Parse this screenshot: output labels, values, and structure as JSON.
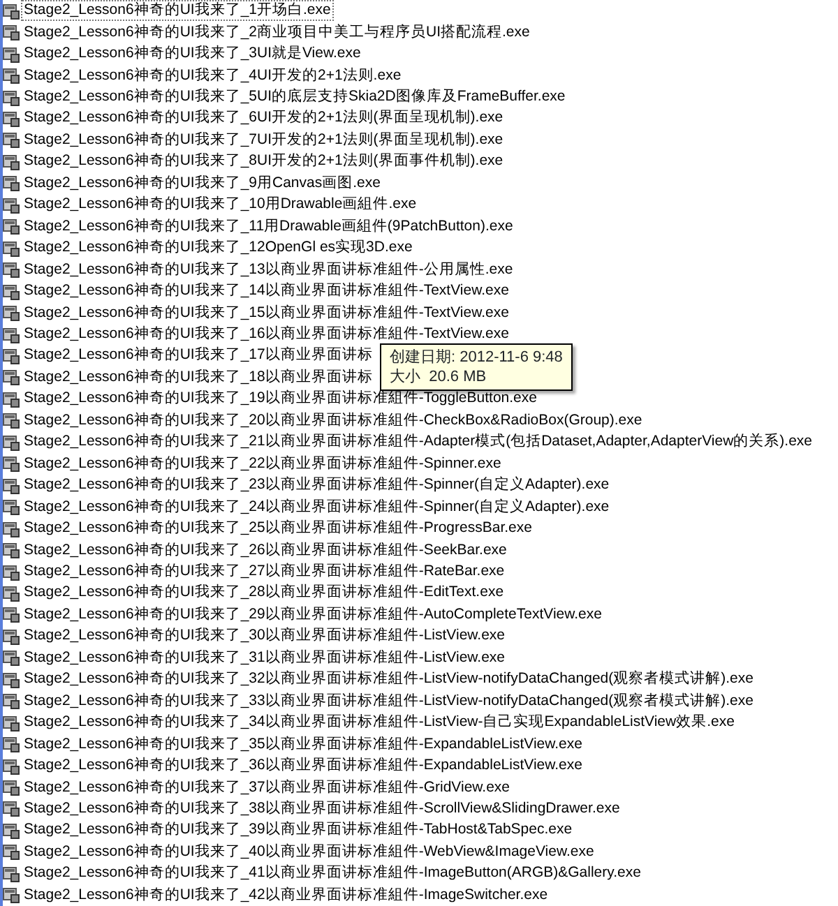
{
  "files": [
    {
      "name": "Stage2_Lesson6神奇的UI我来了_1开场白.exe",
      "focused": true
    },
    {
      "name": "Stage2_Lesson6神奇的UI我来了_2商业项目中美工与程序员UI搭配流程.exe",
      "focused": false
    },
    {
      "name": "Stage2_Lesson6神奇的UI我来了_3UI就是View.exe",
      "focused": false
    },
    {
      "name": "Stage2_Lesson6神奇的UI我来了_4UI开发的2+1法则.exe",
      "focused": false
    },
    {
      "name": "Stage2_Lesson6神奇的UI我来了_5UI的底层支持Skia2D图像库及FrameBuffer.exe",
      "focused": false
    },
    {
      "name": "Stage2_Lesson6神奇的UI我来了_6UI开发的2+1法则(界面呈现机制).exe",
      "focused": false
    },
    {
      "name": "Stage2_Lesson6神奇的UI我来了_7UI开发的2+1法则(界面呈现机制).exe",
      "focused": false
    },
    {
      "name": "Stage2_Lesson6神奇的UI我来了_8UI开发的2+1法则(界面事件机制).exe",
      "focused": false
    },
    {
      "name": "Stage2_Lesson6神奇的UI我来了_9用Canvas画图.exe",
      "focused": false
    },
    {
      "name": "Stage2_Lesson6神奇的UI我来了_10用Drawable画組件.exe",
      "focused": false
    },
    {
      "name": "Stage2_Lesson6神奇的UI我来了_11用Drawable画組件(9PatchButton).exe",
      "focused": false
    },
    {
      "name": "Stage2_Lesson6神奇的UI我来了_12OpenGl es实现3D.exe",
      "focused": false
    },
    {
      "name": "Stage2_Lesson6神奇的UI我来了_13以商业界面讲标准組件-公用属性.exe",
      "focused": false
    },
    {
      "name": "Stage2_Lesson6神奇的UI我来了_14以商业界面讲标准組件-TextView.exe",
      "focused": false
    },
    {
      "name": "Stage2_Lesson6神奇的UI我来了_15以商业界面讲标准組件-TextView.exe",
      "focused": false
    },
    {
      "name": "Stage2_Lesson6神奇的UI我来了_16以商业界面讲标准組件-TextView.exe",
      "focused": false
    },
    {
      "name": "Stage2_Lesson6神奇的UI我来了_17以商业界面讲标",
      "focused": false
    },
    {
      "name": "Stage2_Lesson6神奇的UI我来了_18以商业界面讲标",
      "focused": false
    },
    {
      "name": "Stage2_Lesson6神奇的UI我来了_19以商业界面讲标准組件-ToggleButton.exe",
      "focused": false
    },
    {
      "name": "Stage2_Lesson6神奇的UI我来了_20以商业界面讲标准組件-CheckBox&RadioBox(Group).exe",
      "focused": false
    },
    {
      "name": "Stage2_Lesson6神奇的UI我来了_21以商业界面讲标准組件-Adapter模式(包括Dataset,Adapter,AdapterView的关系).exe",
      "focused": false
    },
    {
      "name": "Stage2_Lesson6神奇的UI我来了_22以商业界面讲标准組件-Spinner.exe",
      "focused": false
    },
    {
      "name": "Stage2_Lesson6神奇的UI我来了_23以商业界面讲标准組件-Spinner(自定义Adapter).exe",
      "focused": false
    },
    {
      "name": "Stage2_Lesson6神奇的UI我来了_24以商业界面讲标准組件-Spinner(自定义Adapter).exe",
      "focused": false
    },
    {
      "name": "Stage2_Lesson6神奇的UI我来了_25以商业界面讲标准組件-ProgressBar.exe",
      "focused": false
    },
    {
      "name": "Stage2_Lesson6神奇的UI我来了_26以商业界面讲标准組件-SeekBar.exe",
      "focused": false
    },
    {
      "name": "Stage2_Lesson6神奇的UI我来了_27以商业界面讲标准組件-RateBar.exe",
      "focused": false
    },
    {
      "name": "Stage2_Lesson6神奇的UI我来了_28以商业界面讲标准組件-EditText.exe",
      "focused": false
    },
    {
      "name": "Stage2_Lesson6神奇的UI我来了_29以商业界面讲标准組件-AutoCompleteTextView.exe",
      "focused": false
    },
    {
      "name": "Stage2_Lesson6神奇的UI我来了_30以商业界面讲标准組件-ListView.exe",
      "focused": false
    },
    {
      "name": "Stage2_Lesson6神奇的UI我来了_31以商业界面讲标准組件-ListView.exe",
      "focused": false
    },
    {
      "name": "Stage2_Lesson6神奇的UI我来了_32以商业界面讲标准組件-ListView-notifyDataChanged(观察者模式讲解).exe",
      "focused": false
    },
    {
      "name": "Stage2_Lesson6神奇的UI我来了_33以商业界面讲标准組件-ListView-notifyDataChanged(观察者模式讲解).exe",
      "focused": false
    },
    {
      "name": "Stage2_Lesson6神奇的UI我来了_34以商业界面讲标准組件-ListView-自己实现ExpandableListView效果.exe",
      "focused": false
    },
    {
      "name": "Stage2_Lesson6神奇的UI我来了_35以商业界面讲标准組件-ExpandableListView.exe",
      "focused": false
    },
    {
      "name": "Stage2_Lesson6神奇的UI我来了_36以商业界面讲标准組件-ExpandableListView.exe",
      "focused": false
    },
    {
      "name": "Stage2_Lesson6神奇的UI我来了_37以商业界面讲标准組件-GridView.exe",
      "focused": false
    },
    {
      "name": "Stage2_Lesson6神奇的UI我来了_38以商业界面讲标准組件-ScrollView&SlidingDrawer.exe",
      "focused": false
    },
    {
      "name": "Stage2_Lesson6神奇的UI我来了_39以商业界面讲标准組件-TabHost&TabSpec.exe",
      "focused": false
    },
    {
      "name": "Stage2_Lesson6神奇的UI我来了_40以商业界面讲标准組件-WebView&ImageView.exe",
      "focused": false
    },
    {
      "name": "Stage2_Lesson6神奇的UI我来了_41以商业界面讲标准組件-ImageButton(ARGB)&Gallery.exe",
      "focused": false
    },
    {
      "name": "Stage2_Lesson6神奇的UI我来了_42以商业界面讲标准組件-ImageSwitcher.exe",
      "focused": false
    }
  ],
  "tooltip": {
    "lines": [
      "创建日期: 2012-11-6 9:48",
      "大小  20.6 MB"
    ]
  }
}
